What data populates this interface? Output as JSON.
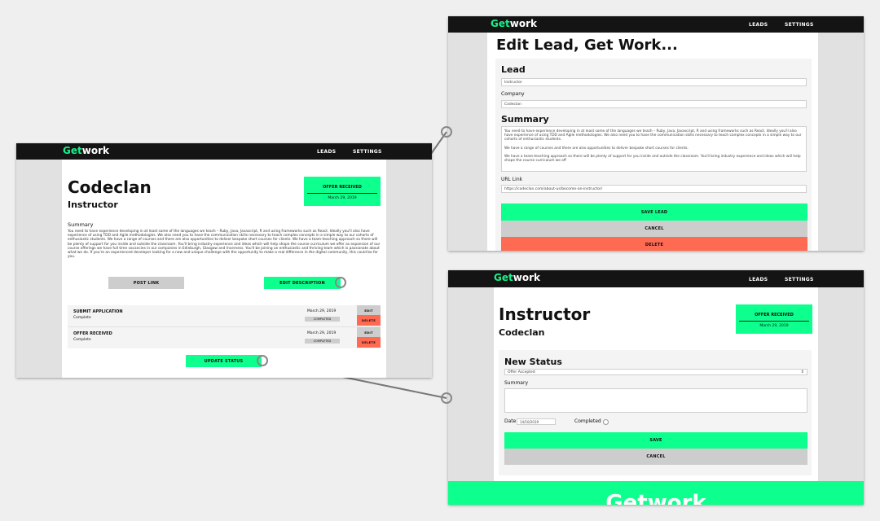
{
  "logo": {
    "get": "Get",
    "work": "work"
  },
  "nav": {
    "leads": "LEADS",
    "settings": "SETTINGS"
  },
  "detail": {
    "company": "Codeclan",
    "role": "Instructor",
    "status_title": "OFFER RECEIVED",
    "status_date": "March 29, 2019",
    "summary_heading": "Summary",
    "summary_text": "You need to have experience developing in at least some of the languages we teach – Ruby, Java, Javascript, R and using frameworks such as React. Ideally you'll also have experience of using TDD and Agile methodologies. We also need you to have the communication skills necessary to teach complex concepts in a simple way to our cohorts of enthusiastic students. We have a range of courses and there are also opportunities to deliver bespoke short courses for clients. We have a team-teaching approach so there will be plenty of support for you inside and outside the classroom. You'll bring industry experience and ideas which will help shape the course curriculum we offer as expansion of our course offerings we have full time vacancies in our companies in Edinburgh, Glasgow and Inverness. You'll be joining an enthusiastic and thriving team which is passionate about what we do. If you're an experienced developer looking for a new and unique challenge with the opportunity to make a real difference in the digital community, this could be for you.",
    "post_link": "POST LINK",
    "edit_description": "EDIT DESCRIPTION",
    "history": [
      {
        "title": "SUBMIT APPLICATION",
        "sub": "Complete",
        "date": "March 29, 2019",
        "badge": "COMPLETED",
        "edit": "EDIT",
        "delete": "DELETE"
      },
      {
        "title": "OFFER RECEIVED",
        "sub": "Complete",
        "date": "March 29, 2019",
        "badge": "COMPLETED",
        "edit": "EDIT",
        "delete": "DELETE"
      }
    ],
    "update_status": "UPDATE STATUS"
  },
  "edit": {
    "title": "Edit Lead, Get Work...",
    "lead_heading": "Lead",
    "lead_value": "Instructor",
    "company_label": "Company",
    "company_value": "Codeclan",
    "summary_heading": "Summary",
    "summary_p1": "You need to have experience developing in at least some of the languages we teach – Ruby, Java, Javascript, R and using frameworks such as React. Ideally you'll also have experience of using TDD and Agile methodologies. We also need you to have the communication skills necessary to teach complex concepts in a simple way to our cohorts of enthusiastic students.",
    "summary_p2": "We have a range of courses and there are also opportunities to deliver bespoke short courses for clients.",
    "summary_p3": "We have a team-teaching approach so there will be plenty of support for you inside and outside the classroom. You'll bring industry experience and ideas which will help shape the course curriculum we off",
    "url_label": "URL Link",
    "url_value": "https://codeclan.com/about-us/become-an-instructor/",
    "save": "SAVE LEAD",
    "cancel": "CANCEL",
    "delete": "DELETE"
  },
  "status": {
    "role": "Instructor",
    "company": "Codeclan",
    "status_title": "OFFER RECEIVED",
    "status_date": "March 29, 2019",
    "new_status_heading": "New Status",
    "select_value": "Offer Accepted",
    "summary_label": "Summary",
    "date_label": "Date",
    "date_value": "14/10/2019",
    "completed_label": "Completed",
    "save": "SAVE",
    "cancel": "CANCEL",
    "footer_logo": "Getwork"
  },
  "colors": {
    "accent": "#0dff8d",
    "danger": "#fe6a52",
    "neutral": "#cdcdcd",
    "nav": "#141414"
  }
}
